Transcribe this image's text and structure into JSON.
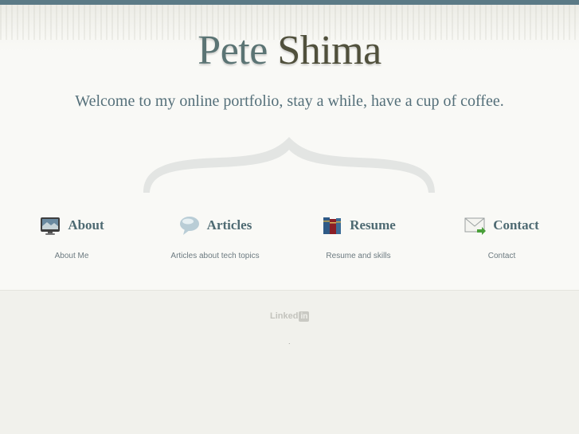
{
  "header": {
    "title_first": "Pete",
    "title_last": "Shima",
    "tagline": "Welcome to my online portfolio, stay a while, have a cup of coffee."
  },
  "nav": {
    "items": [
      {
        "label": "About",
        "description": "About Me",
        "icon": "monitor-icon"
      },
      {
        "label": "Articles",
        "description": "Articles about tech topics",
        "icon": "speech-bubble-icon"
      },
      {
        "label": "Resume",
        "description": "Resume and skills",
        "icon": "books-icon"
      },
      {
        "label": "Contact",
        "description": "Contact",
        "icon": "envelope-icon"
      }
    ]
  },
  "footer": {
    "linkedin_text": "Linked",
    "linkedin_badge": "in",
    "dot": "."
  },
  "colors": {
    "topbar": "#5b7a86",
    "title": "#5b7474",
    "tagline": "#55707a",
    "nav_label": "#4e6a72"
  }
}
